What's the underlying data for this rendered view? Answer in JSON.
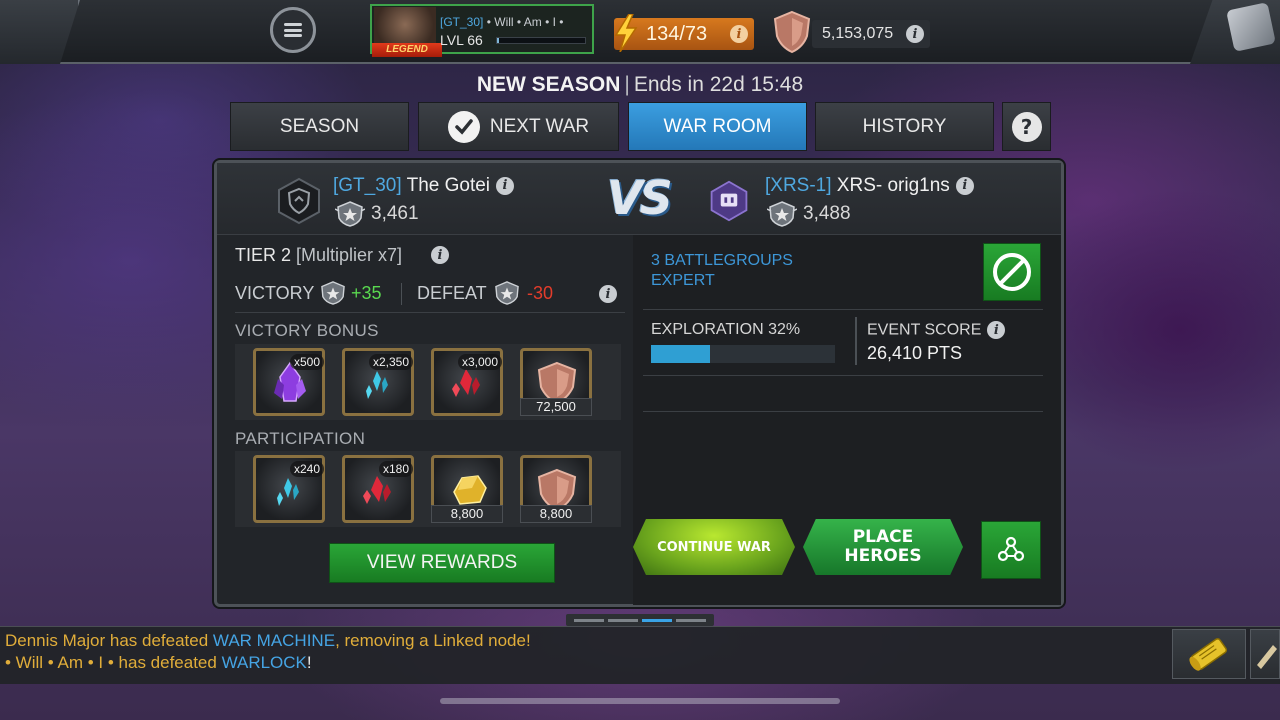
{
  "topbar": {
    "player_tag": "[GT_30]",
    "player_name": "• Will • Am • I •",
    "player_level": "LVL 66",
    "player_badge": "LEGEND",
    "xp_fraction": 0.02,
    "energy": "134/73",
    "gold": "5,153,075"
  },
  "season": {
    "title": "NEW SEASON",
    "separator": "|",
    "ends": "Ends in 22d 15:48"
  },
  "tabs": [
    {
      "label": "SEASON",
      "active": false
    },
    {
      "label": "NEXT WAR",
      "active": false
    },
    {
      "label": "WAR ROOM",
      "active": true
    },
    {
      "label": "HISTORY",
      "active": false
    }
  ],
  "alliances": {
    "home": {
      "tag": "[GT_30]",
      "name": " The Gotei",
      "rating": "3,461"
    },
    "vs": "VS",
    "enemy": {
      "tag": "[XRS-1]",
      "name": " XRS- orig1ns",
      "rating": "3,488"
    }
  },
  "tier": {
    "label": "TIER 2",
    "multiplier": "[Multiplier x7]",
    "victory_label": "VICTORY",
    "victory_value": "+35",
    "defeat_label": "DEFEAT",
    "defeat_value": "-30"
  },
  "victory_bonus": {
    "label": "VICTORY BONUS",
    "items": [
      {
        "icon": "purple-crystal-icon",
        "count": "x500",
        "amount": ""
      },
      {
        "icon": "cyan-shards-icon",
        "count": "x2,350",
        "amount": ""
      },
      {
        "icon": "red-shards-icon",
        "count": "x3,000",
        "amount": ""
      },
      {
        "icon": "bronze-shield-icon",
        "count": "",
        "amount": "72,500"
      }
    ]
  },
  "participation": {
    "label": "PARTICIPATION",
    "items": [
      {
        "icon": "cyan-shards-icon",
        "count": "x240",
        "amount": ""
      },
      {
        "icon": "red-shards-icon",
        "count": "x180",
        "amount": ""
      },
      {
        "icon": "gold-nugget-icon",
        "count": "",
        "amount": "8,800"
      },
      {
        "icon": "bronze-shield-icon",
        "count": "",
        "amount": "8,800"
      }
    ]
  },
  "view_rewards": "VIEW REWARDS",
  "war_info": {
    "battlegroups_line1": "3 BATTLEGROUPS",
    "battlegroups_line2": "EXPERT",
    "exploration_label": "EXPLORATION 32%",
    "exploration_fraction": 0.32,
    "event_score_label": "EVENT SCORE",
    "event_score_value": "26,410 PTS"
  },
  "actions": {
    "continue_war": "CONTINUE WAR",
    "place_heroes_line1": "PLACE",
    "place_heroes_line2": "HEROES"
  },
  "ticker": {
    "line1_player": "Dennis Major has defeated ",
    "line1_hero": "WAR MACHINE",
    "line1_rest": ", removing a Linked node!",
    "line2_player": "• Will • Am • I •  has defeated ",
    "line2_hero": "WARLOCK",
    "line2_rest": "!"
  },
  "colors": {
    "accent_blue": "#3b9ee0",
    "action_green": "#2aa637",
    "gain": "#59d84f",
    "loss": "#e23c2b"
  }
}
